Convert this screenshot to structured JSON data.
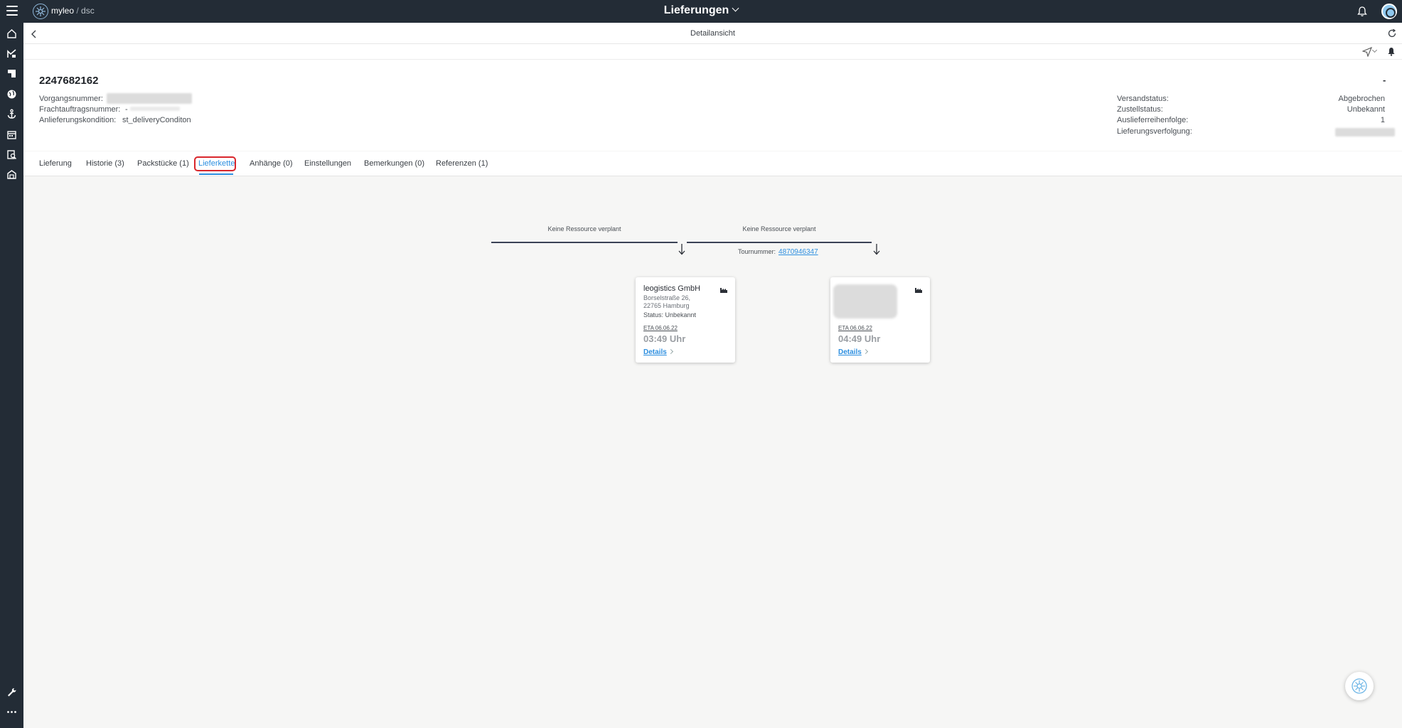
{
  "topbar": {
    "brand_name": "myleo",
    "brand_sep": "/",
    "brand_sub": "dsc",
    "title": "Lieferungen"
  },
  "subheader": {
    "title": "Detailansicht"
  },
  "header": {
    "id": "2247682162",
    "dash": "-",
    "left_fields": [
      {
        "label": "Vorgangsnummer:",
        "value": ""
      },
      {
        "label": "Frachtauftragsnummer:",
        "value": "-"
      },
      {
        "label": "Anlieferungskondition:",
        "value": "st_deliveryConditon"
      }
    ],
    "right_fields": [
      {
        "label": "Versandstatus:",
        "value": "Abgebrochen"
      },
      {
        "label": "Zustellstatus:",
        "value": "Unbekannt"
      },
      {
        "label": "Auslieferreihenfolge:",
        "value": "1"
      },
      {
        "label": "Lieferungsverfolgung:",
        "value": ""
      }
    ]
  },
  "tabs": [
    {
      "label": "Lieferung"
    },
    {
      "label": "Historie (3)"
    },
    {
      "label": "Packstücke (1)"
    },
    {
      "label": "Lieferkette"
    },
    {
      "label": "Anhänge (0)"
    },
    {
      "label": "Einstellungen"
    },
    {
      "label": "Bemerkungen (0)"
    },
    {
      "label": "Referenzen (1)"
    }
  ],
  "chain": {
    "segments": [
      {
        "label": "Keine Ressource verplant"
      },
      {
        "label": "Keine Ressource verplant"
      }
    ],
    "tour_label": "Tournummer:",
    "tour_number": "4870946347",
    "nodes": [
      {
        "name": "leogistics GmbH",
        "address_line1": "Borselstraße 26,",
        "address_line2": "22765 Hamburg",
        "status": "Status: Unbekannt",
        "eta": "ETA 06.06.22",
        "time": "03:49 Uhr",
        "details": "Details"
      },
      {
        "eta": "ETA 06.06.22",
        "time": "04:49 Uhr",
        "details": "Details"
      }
    ]
  },
  "colors": {
    "topbar": "#232c36",
    "accent": "#2d8fe0",
    "highlight": "#d9262b"
  }
}
